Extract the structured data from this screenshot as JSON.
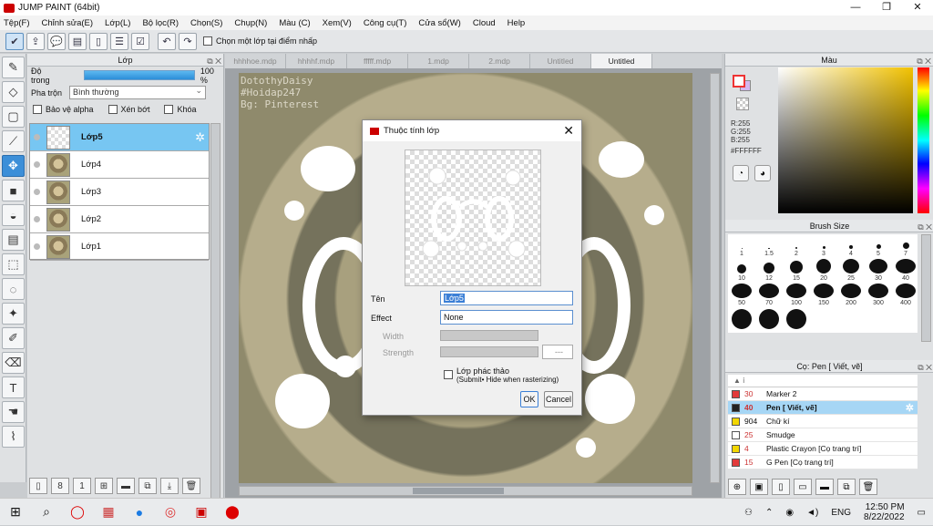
{
  "window": {
    "title": "JUMP PAINT (64bit)",
    "controls": [
      "—",
      "❐",
      "✕"
    ]
  },
  "menu": [
    "Tệp(F)",
    "Chỉnh sửa(E)",
    "Lớp(L)",
    "Bộ lọc(R)",
    "Chọn(S)",
    "Chụp(N)",
    "Màu (C)",
    "Xem(V)",
    "Công cụ(T)",
    "Cửa sổ(W)",
    "Cloud",
    "Help"
  ],
  "toolbar": {
    "sketch_label": "Chọn một lớp tại điểm nhấp"
  },
  "layer_panel": {
    "title": "Lớp",
    "opacity_label": "Độ trong",
    "opacity_value": "100 %",
    "opacity": 100,
    "blend_label": "Pha trộn",
    "blend_value": "Bình thường",
    "protect_alpha": "Bảo vệ alpha",
    "clipping": "Xén bớt",
    "lock": "Khóa",
    "layers": [
      {
        "name": "Lớp5",
        "selected": true
      },
      {
        "name": "Lớp4",
        "selected": false
      },
      {
        "name": "Lớp3",
        "selected": false
      },
      {
        "name": "Lớp2",
        "selected": false
      },
      {
        "name": "Lớp1",
        "selected": false
      }
    ]
  },
  "canvas": {
    "tabs": [
      "hhhhoe.mdp",
      "hhhhf.mdp",
      "fffff.mdp",
      "1.mdp",
      "2.mdp",
      "Untitled",
      "Untitled"
    ],
    "active_tab": 6,
    "watermark": [
      "DotothyDaisy",
      "#Hoidap247",
      "Bg: Pinterest"
    ]
  },
  "color_panel": {
    "title": "Màu",
    "r": "R:255",
    "g": "G:255",
    "b": "B:255",
    "hex": "#FFFFFF",
    "accent": "#3c8fd8"
  },
  "brush_panel": {
    "title": "Brush Size",
    "sizes": [
      "1",
      "1.5",
      "2",
      "3",
      "4",
      "5",
      "7",
      "10",
      "12",
      "15",
      "20",
      "25",
      "30",
      "40",
      "50",
      "70",
      "100",
      "150",
      "200",
      "300",
      "400",
      "",
      "",
      ""
    ]
  },
  "pen_panel": {
    "title": "Cọ: Pen [ Viết, vẽ]",
    "pens": [
      {
        "size": "30",
        "name": "Marker 2",
        "color": "#e33b3b"
      },
      {
        "size": "40",
        "name": "Pen [ Viết, vẽ]",
        "color": "#222222",
        "selected": true
      },
      {
        "size": "904",
        "name": "Chữ kí",
        "color": "#f2d600"
      },
      {
        "size": "25",
        "name": "Smudge",
        "color": "#ffffff"
      },
      {
        "size": "4",
        "name": "Plastic Crayon [Cọ trang trí]",
        "color": "#f2d600"
      },
      {
        "size": "15",
        "name": "G Pen [Cọ trang trí]",
        "color": "#e33b3b"
      }
    ]
  },
  "dialog": {
    "title": "Thuộc tính lớp",
    "name_label": "Tên",
    "name_value": "Lớp5",
    "effect_label": "Effect",
    "effect_value": "None",
    "width_label": "Width",
    "strength_label": "Strength",
    "strength_value": "---",
    "sketch_checkbox": "Lớp phác thảo",
    "sketch_note": "(Submit• Hide when rasterizing)",
    "ok": "OK",
    "cancel": "Cancel"
  },
  "taskbar": {
    "lang": "ENG",
    "time": "12:50 PM",
    "date": "8/22/2022"
  }
}
